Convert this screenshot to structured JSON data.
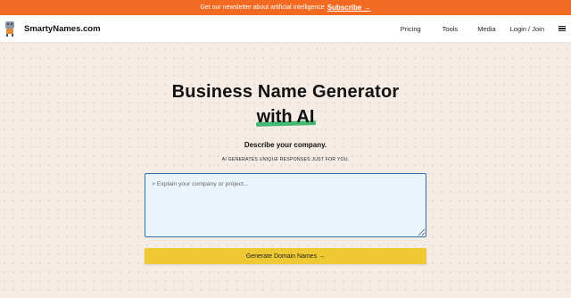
{
  "banner": {
    "text": "Get our newsletter about artificial intelligence",
    "subscribe_label": "Subscribe →",
    "color": "#f26a22"
  },
  "nav": {
    "brand": "SmartyNames.com",
    "logo_icon": "robot-icon",
    "links": [
      "Pricing",
      "Tools",
      "Media",
      "Login / Join"
    ],
    "menu_icon": "hamburger-icon"
  },
  "hero": {
    "title_line1": "Business Name Generator",
    "title_line2": "with AI",
    "underline_color": "#42b873"
  },
  "description": {
    "heading": "Describe your company.",
    "tagline_prefix": "AI GENERATES ",
    "tagline_emphasis": "UNIQUE",
    "tagline_suffix": " RESPONSES JUST FOR YOU."
  },
  "prompt": {
    "placeholder": "> Explain your company or project...",
    "value": ""
  },
  "generate_button": {
    "label": "Generate Domain Names →",
    "color": "#eec933"
  }
}
